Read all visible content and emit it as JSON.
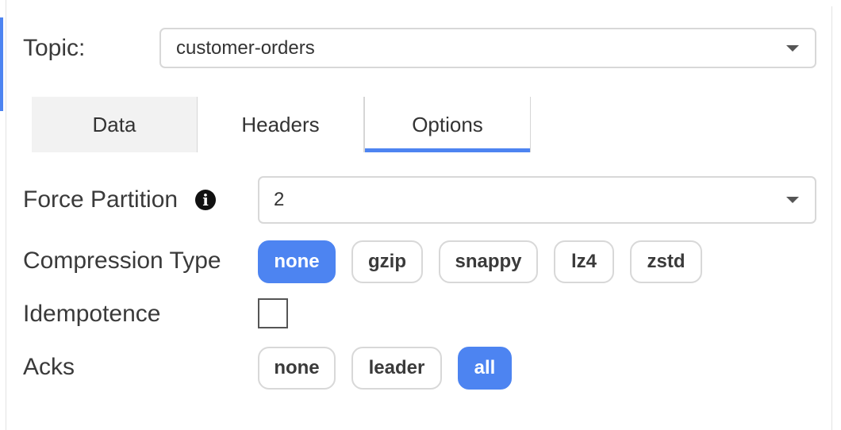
{
  "topic": {
    "label": "Topic:",
    "value": "customer-orders"
  },
  "tabs": [
    {
      "label": "Data",
      "active": false
    },
    {
      "label": "Headers",
      "active": false
    },
    {
      "label": "Options",
      "active": true
    }
  ],
  "options": {
    "force_partition": {
      "label": "Force Partition",
      "value": "2",
      "info_icon": "info-icon"
    },
    "compression": {
      "label": "Compression Type",
      "choices": [
        "none",
        "gzip",
        "snappy",
        "lz4",
        "zstd"
      ],
      "selected": "none"
    },
    "idempotence": {
      "label": "Idempotence",
      "checked": false
    },
    "acks": {
      "label": "Acks",
      "choices": [
        "none",
        "leader",
        "all"
      ],
      "selected": "all"
    }
  },
  "colors": {
    "accent": "#4d84f1",
    "inactive_tab": "#f2f2f2",
    "border": "#d8d8d8"
  }
}
